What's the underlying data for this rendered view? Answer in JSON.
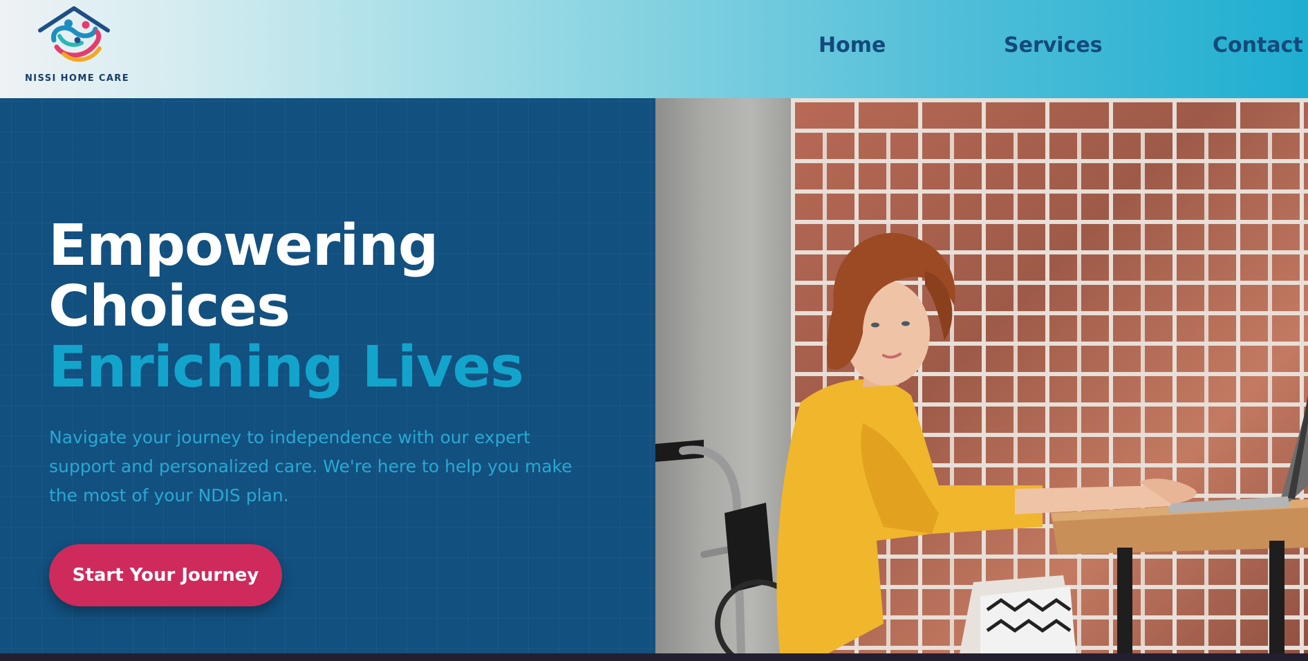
{
  "header": {
    "logo_text": "NISSI HOME CARE",
    "nav": {
      "home": "Home",
      "services": "Services",
      "contact": "Contact"
    }
  },
  "hero": {
    "headline_line1": "Empowering",
    "headline_line2": "Choices",
    "headline_accent": "Enriching Lives",
    "subtext": "Navigate your journey to independence with our expert support and personalized care. We're here to help you make the most of your NDIS plan.",
    "cta_label": "Start Your Journey",
    "photo_alt": "Woman in a wheelchair working on a laptop"
  },
  "colors": {
    "primary_dark": "#12507f",
    "accent_cyan": "#13a4cc",
    "cta_pink": "#cf2a5c",
    "nav_text": "#124a7a"
  },
  "icons": {
    "logo": "house-with-people-logo-icon"
  }
}
